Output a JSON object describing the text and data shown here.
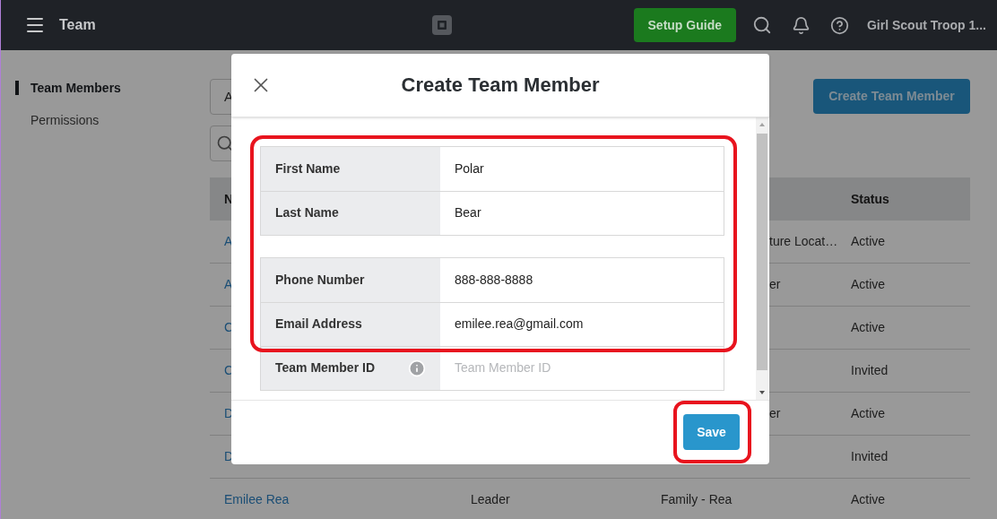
{
  "top_bar": {
    "title": "Team",
    "setup_button": "Setup Guide",
    "account": "Girl Scout Troop 1..."
  },
  "sidebar": {
    "items": [
      {
        "label": "Team Members",
        "selected": true
      },
      {
        "label": "Permissions",
        "selected": false
      }
    ]
  },
  "toolbar": {
    "filter_value": "A",
    "create_button": "Create Team Member"
  },
  "table": {
    "header": {
      "name": "N",
      "status": "Status"
    },
    "rows": [
      {
        "name": "A",
        "location": "ture Locat…",
        "status": "Active"
      },
      {
        "name": "A",
        "location": "er",
        "status": "Active"
      },
      {
        "name": "C",
        "status": "Active"
      },
      {
        "name": "C",
        "status": "Invited"
      },
      {
        "name": "D",
        "location": "er",
        "status": "Active"
      },
      {
        "name": "D",
        "status": "Invited"
      },
      {
        "name": "Emilee Rea",
        "role": "Leader",
        "location": "Family - Rea",
        "status": "Active"
      }
    ]
  },
  "modal": {
    "title": "Create Team Member",
    "sections": [
      [
        {
          "label": "First Name",
          "value": "Polar"
        },
        {
          "label": "Last Name",
          "value": "Bear"
        }
      ],
      [
        {
          "label": "Phone Number",
          "value": "888-888-8888"
        },
        {
          "label": "Email Address",
          "value": "emilee.rea@gmail.com"
        },
        {
          "label": "Team Member ID",
          "placeholder": "Team Member ID",
          "info": true
        }
      ]
    ],
    "save_button": "Save"
  }
}
